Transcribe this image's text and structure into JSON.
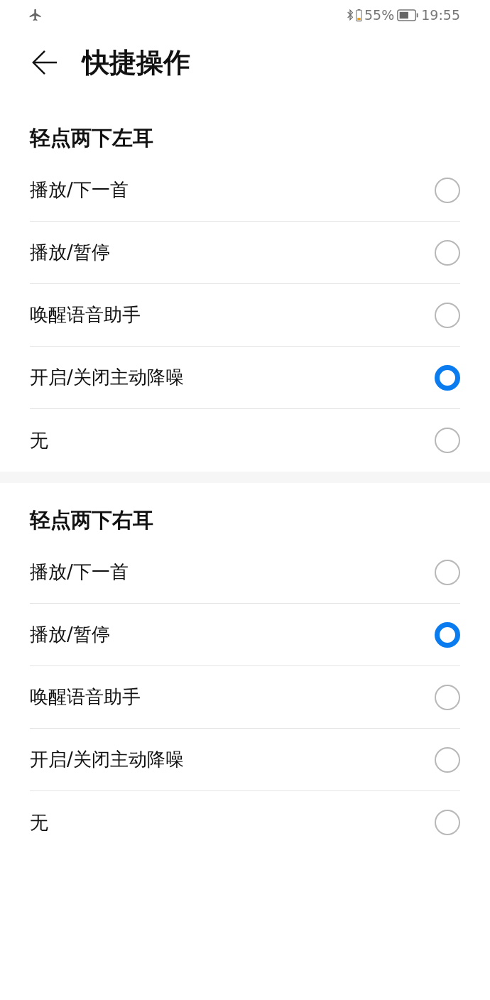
{
  "status_bar": {
    "battery_percent": "55%",
    "time": "19:55"
  },
  "header": {
    "title": "快捷操作"
  },
  "sections": [
    {
      "title": "轻点两下左耳",
      "options": [
        {
          "label": "播放/下一首",
          "selected": false
        },
        {
          "label": "播放/暂停",
          "selected": false
        },
        {
          "label": "唤醒语音助手",
          "selected": false
        },
        {
          "label": "开启/关闭主动降噪",
          "selected": true
        },
        {
          "label": "无",
          "selected": false
        }
      ]
    },
    {
      "title": "轻点两下右耳",
      "options": [
        {
          "label": "播放/下一首",
          "selected": false
        },
        {
          "label": "播放/暂停",
          "selected": true
        },
        {
          "label": "唤醒语音助手",
          "selected": false
        },
        {
          "label": "开启/关闭主动降噪",
          "selected": false
        },
        {
          "label": "无",
          "selected": false
        }
      ]
    }
  ]
}
